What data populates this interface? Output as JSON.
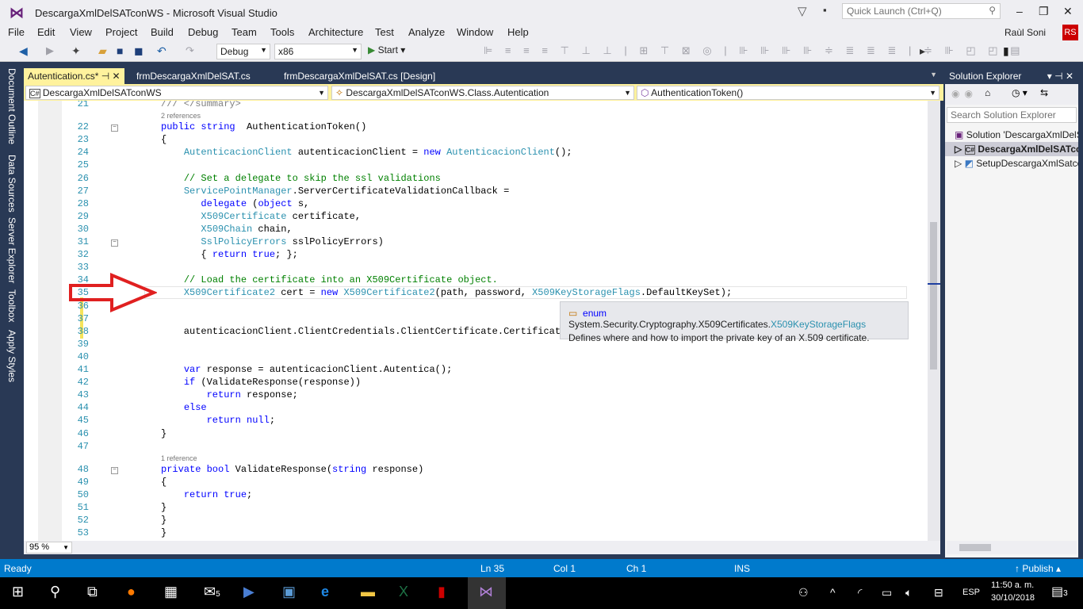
{
  "window": {
    "title": "DescargaXmlDelSATconWS - Microsoft Visual Studio",
    "quick_launch_placeholder": "Quick Launch (Ctrl+Q)",
    "user": "Raùl Soni",
    "avatar": "RS"
  },
  "menu": [
    "File",
    "Edit",
    "View",
    "Project",
    "Build",
    "Debug",
    "Team",
    "Tools",
    "Architecture",
    "Test",
    "Analyze",
    "Window",
    "Help"
  ],
  "toolbar": {
    "config": "Debug",
    "platform": "x86",
    "start": "Start"
  },
  "left_tabs": [
    "Document Outline",
    "Data Sources",
    "Server Explorer",
    "Toolbox",
    "Apply Styles"
  ],
  "doc_tabs": [
    {
      "label": "Autentication.cs*",
      "active": true
    },
    {
      "label": "frmDescargaXmlDelSAT.cs"
    },
    {
      "label": "frmDescargaXmlDelSAT.cs [Design]"
    }
  ],
  "nav": {
    "project": "DescargaXmlDelSATconWS",
    "class": "DescargaXmlDelSATconWS.Class.Autentication",
    "member": "AuthenticationToken()"
  },
  "code": [
    {
      "n": 21,
      "t": [
        [
          "doc",
          "/// </summary>"
        ]
      ]
    },
    {
      "ref": "2 references"
    },
    {
      "n": 22,
      "fold": true,
      "t": [
        [
          "kw",
          "public "
        ],
        [
          "kw",
          "string"
        ],
        [
          "",
          "  AuthenticationToken()"
        ]
      ]
    },
    {
      "n": 23,
      "t": [
        [
          "",
          "{"
        ]
      ]
    },
    {
      "n": 24,
      "t": [
        [
          "",
          "    "
        ],
        [
          "type",
          "AutenticacionClient"
        ],
        [
          "",
          " autenticacionClient = "
        ],
        [
          "kw",
          "new "
        ],
        [
          "type",
          "AutenticacionClient"
        ],
        [
          "",
          "();"
        ]
      ]
    },
    {
      "n": 25,
      "t": []
    },
    {
      "n": 26,
      "t": [
        [
          "",
          "    "
        ],
        [
          "cm",
          "// Set a delegate to skip the ssl validations"
        ]
      ]
    },
    {
      "n": 27,
      "t": [
        [
          "",
          "    "
        ],
        [
          "type",
          "ServicePointManager"
        ],
        [
          "",
          ".ServerCertificateValidationCallback ="
        ]
      ]
    },
    {
      "n": 28,
      "t": [
        [
          "",
          "       "
        ],
        [
          "kw",
          "delegate"
        ],
        [
          "",
          " ("
        ],
        [
          "kw",
          "object"
        ],
        [
          "",
          " s,"
        ]
      ]
    },
    {
      "n": 29,
      "t": [
        [
          "",
          "       "
        ],
        [
          "type",
          "X509Certificate"
        ],
        [
          "",
          " certificate,"
        ]
      ]
    },
    {
      "n": 30,
      "t": [
        [
          "",
          "       "
        ],
        [
          "type",
          "X509Chain"
        ],
        [
          "",
          " chain,"
        ]
      ]
    },
    {
      "n": 31,
      "fold": true,
      "t": [
        [
          "",
          "       "
        ],
        [
          "type",
          "SslPolicyErrors"
        ],
        [
          "",
          " sslPolicyErrors)"
        ]
      ]
    },
    {
      "n": 32,
      "t": [
        [
          "",
          "       { "
        ],
        [
          "kw",
          "return "
        ],
        [
          "kw",
          "true"
        ],
        [
          "",
          "; };"
        ]
      ]
    },
    {
      "n": 33,
      "t": []
    },
    {
      "n": 34,
      "t": [
        [
          "",
          "    "
        ],
        [
          "cm",
          "// Load the certificate into an X509Certificate object."
        ]
      ]
    },
    {
      "n": 35,
      "t": [
        [
          "",
          "    "
        ],
        [
          "type",
          "X509Certificate2"
        ],
        [
          "",
          " cert = "
        ],
        [
          "kw",
          "new "
        ],
        [
          "type",
          "X509Certificate2"
        ],
        [
          "",
          "(path, password, "
        ],
        [
          "type",
          "X509KeyStorageFlags"
        ],
        [
          "",
          ".DefaultKeySet);"
        ]
      ]
    },
    {
      "n": 36,
      "t": []
    },
    {
      "n": 37,
      "t": []
    },
    {
      "n": 38,
      "t": [
        [
          "",
          "    autenticacionClient.ClientCredentials.ClientCertificate.Certificate = cert;"
        ]
      ]
    },
    {
      "n": 39,
      "t": []
    },
    {
      "n": 40,
      "t": []
    },
    {
      "n": 41,
      "t": [
        [
          "",
          "    "
        ],
        [
          "kw",
          "var"
        ],
        [
          "",
          " response = autenticacionClient.Autentica();"
        ]
      ]
    },
    {
      "n": 42,
      "t": [
        [
          "",
          "    "
        ],
        [
          "kw",
          "if"
        ],
        [
          "",
          " (ValidateResponse(response))"
        ]
      ]
    },
    {
      "n": 43,
      "t": [
        [
          "",
          "        "
        ],
        [
          "kw",
          "return"
        ],
        [
          "",
          " response;"
        ]
      ]
    },
    {
      "n": 44,
      "t": [
        [
          "",
          "    "
        ],
        [
          "kw",
          "else"
        ]
      ]
    },
    {
      "n": 45,
      "t": [
        [
          "",
          "        "
        ],
        [
          "kw",
          "return "
        ],
        [
          "kw",
          "null"
        ],
        [
          "",
          ";"
        ]
      ]
    },
    {
      "n": 46,
      "t": [
        [
          "",
          "}"
        ]
      ]
    },
    {
      "n": 47,
      "t": []
    },
    {
      "ref": "1 reference"
    },
    {
      "n": 48,
      "fold": true,
      "t": [
        [
          "kw",
          "private "
        ],
        [
          "kw",
          "bool"
        ],
        [
          "",
          " ValidateResponse("
        ],
        [
          "kw",
          "string"
        ],
        [
          "",
          " response)"
        ]
      ]
    },
    {
      "n": 49,
      "t": [
        [
          "",
          "{"
        ]
      ]
    },
    {
      "n": 50,
      "t": [
        [
          "",
          "    "
        ],
        [
          "kw",
          "return "
        ],
        [
          "kw",
          "true"
        ],
        [
          "",
          ";"
        ]
      ]
    },
    {
      "n": 51,
      "t": [
        [
          "",
          "}"
        ]
      ]
    },
    {
      "n": 52,
      "t": [
        [
          "",
          "}"
        ]
      ]
    },
    {
      "n": 53,
      "t": [
        [
          "",
          "}"
        ]
      ]
    }
  ],
  "tooltip": {
    "kind": "enum",
    "namespace": "System.Security.Cryptography.X509Certificates.",
    "type": "X509KeyStorageFlags",
    "description": "Defines where and how to import the private key of an X.509 certificate."
  },
  "zoom_level": "95 %",
  "solution_explorer": {
    "title": "Solution Explorer",
    "search_placeholder": "Search Solution Explorer",
    "items": [
      "Solution 'DescargaXmlDelSATconWS'",
      "DescargaXmlDelSATconWS",
      "SetupDescargaXmlSatconWS"
    ]
  },
  "status": {
    "ready": "Ready",
    "ln": "Ln 35",
    "col": "Col 1",
    "ch": "Ch 1",
    "ins": "INS",
    "publish": "Publish"
  },
  "taskbar": {
    "time": "11:50 a. m.",
    "date": "30/10/2018",
    "lang": "ESP",
    "mail_badge": "5",
    "notif_badge": "3"
  },
  "colors": {
    "accent": "#007acc",
    "arrow": "#e02020",
    "keyword": "#0000ff",
    "type": "#2b91af",
    "comment": "#008000"
  }
}
